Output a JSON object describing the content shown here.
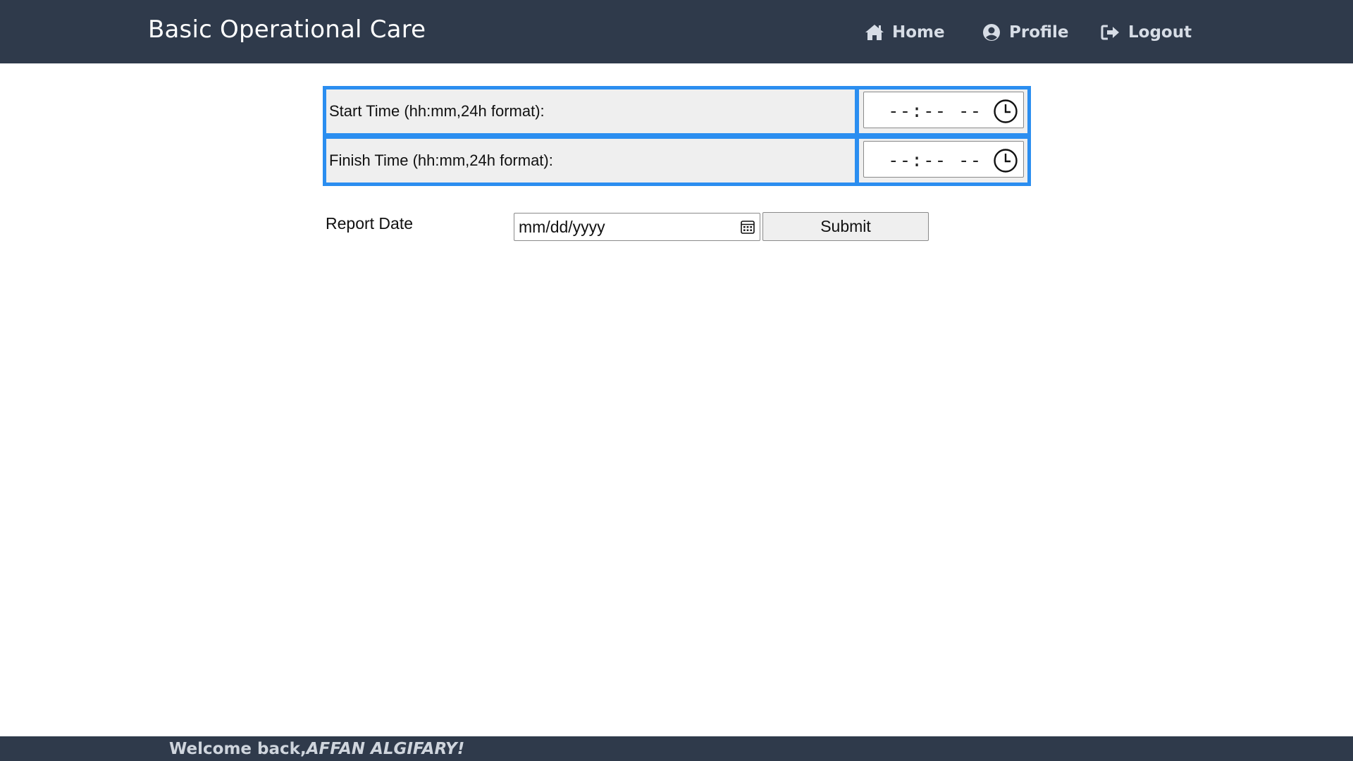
{
  "navbar": {
    "brand": "Basic Operational Care",
    "items": [
      {
        "label": "Home",
        "icon": "home-icon"
      },
      {
        "label": "Profile",
        "icon": "user-circle-icon"
      },
      {
        "label": "Logout",
        "icon": "logout-icon"
      }
    ]
  },
  "time_form": {
    "rows": [
      {
        "label": "Start Time (hh:mm,24h format):",
        "placeholder": "--:-- --",
        "icon": "clock-icon"
      },
      {
        "label": "Finish Time (hh:mm,24h format):",
        "placeholder": "--:-- --",
        "icon": "clock-icon"
      }
    ]
  },
  "report": {
    "label": "Report Date",
    "date_placeholder": "mm/dd/yyyy",
    "date_icon": "calendar-icon",
    "submit_label": "Submit"
  },
  "footer": {
    "welcome_prefix": "Welcome back,",
    "user_name": "AFFAN ALGIFARY!"
  },
  "colors": {
    "navbar_bg": "#2f3a4b",
    "nav_text": "#d7dde6",
    "table_border": "#2b8ef0",
    "cell_bg": "#efefef"
  }
}
